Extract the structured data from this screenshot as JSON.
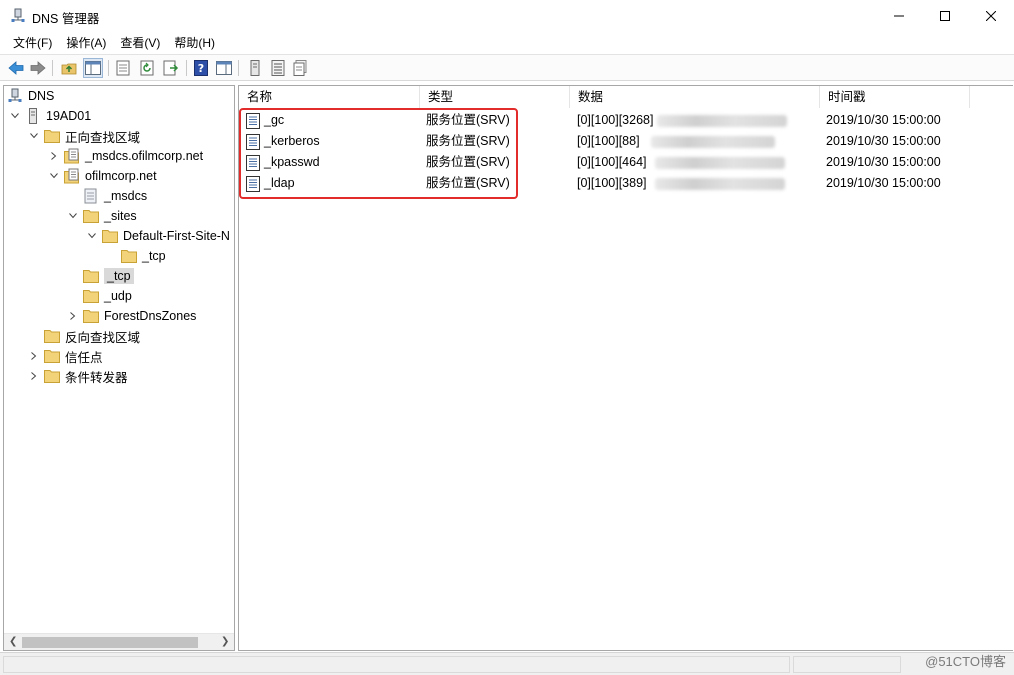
{
  "window": {
    "title": "DNS 管理器",
    "icons": {
      "app": "dns-server-icon",
      "minimize": "minimize-icon",
      "maximize": "maximize-icon",
      "close": "close-icon"
    }
  },
  "menu": {
    "items": [
      {
        "label": "文件(F)"
      },
      {
        "label": "操作(A)"
      },
      {
        "label": "查看(V)"
      },
      {
        "label": "帮助(H)"
      }
    ]
  },
  "toolbar": {
    "buttons": [
      "back-arrow-icon",
      "forward-arrow-icon",
      "up-folder-icon",
      "show-hide-console-tree-icon",
      "properties-icon",
      "refresh-icon",
      "export-list-icon",
      "help-icon",
      "show-hide-action-pane-icon",
      "server-icon",
      "list-icon",
      "records-icon"
    ]
  },
  "tree": {
    "items": [
      {
        "label": "DNS",
        "icon": "dns-icon",
        "expander": ""
      },
      {
        "label": "19AD01",
        "icon": "server-icon",
        "expander": "expanded"
      },
      {
        "label": "正向查找区域",
        "icon": "folder-icon",
        "expander": "expanded"
      },
      {
        "label": "_msdcs.ofilmcorp.net",
        "icon": "zone-icon",
        "expander": "collapsed"
      },
      {
        "label": "ofilmcorp.net",
        "icon": "zone-icon",
        "expander": "expanded"
      },
      {
        "label": "_msdcs",
        "icon": "delegation-icon",
        "expander": ""
      },
      {
        "label": "_sites",
        "icon": "folder-icon",
        "expander": "expanded"
      },
      {
        "label": "Default-First-Site-N",
        "icon": "folder-icon",
        "expander": "expanded"
      },
      {
        "label": "_tcp",
        "icon": "folder-icon",
        "expander": ""
      },
      {
        "label": "_tcp",
        "icon": "folder-icon",
        "expander": "",
        "selected": true
      },
      {
        "label": "_udp",
        "icon": "folder-icon",
        "expander": ""
      },
      {
        "label": "ForestDnsZones",
        "icon": "folder-icon",
        "expander": "collapsed"
      },
      {
        "label": "反向查找区域",
        "icon": "folder-icon",
        "expander": ""
      },
      {
        "label": "信任点",
        "icon": "folder-icon",
        "expander": "collapsed"
      },
      {
        "label": "条件转发器",
        "icon": "folder-icon",
        "expander": "collapsed"
      }
    ]
  },
  "list": {
    "columns": [
      "名称",
      "类型",
      "数据",
      "时间戳"
    ],
    "rows": [
      {
        "name": "_gc",
        "type": "服务位置(SRV)",
        "data": "[0][100][3268]",
        "timestamp": "2019/10/30 15:00:00"
      },
      {
        "name": "_kerberos",
        "type": "服务位置(SRV)",
        "data": "[0][100][88]",
        "timestamp": "2019/10/30 15:00:00"
      },
      {
        "name": "_kpasswd",
        "type": "服务位置(SRV)",
        "data": "[0][100][464]",
        "timestamp": "2019/10/30 15:00:00"
      },
      {
        "name": "_ldap",
        "type": "服务位置(SRV)",
        "data": "[0][100][389]",
        "timestamp": "2019/10/30 15:00:00"
      }
    ],
    "row_icon": "srv-record-icon",
    "highlight_color": "#e22b2b"
  },
  "watermark": "@51CTO博客"
}
